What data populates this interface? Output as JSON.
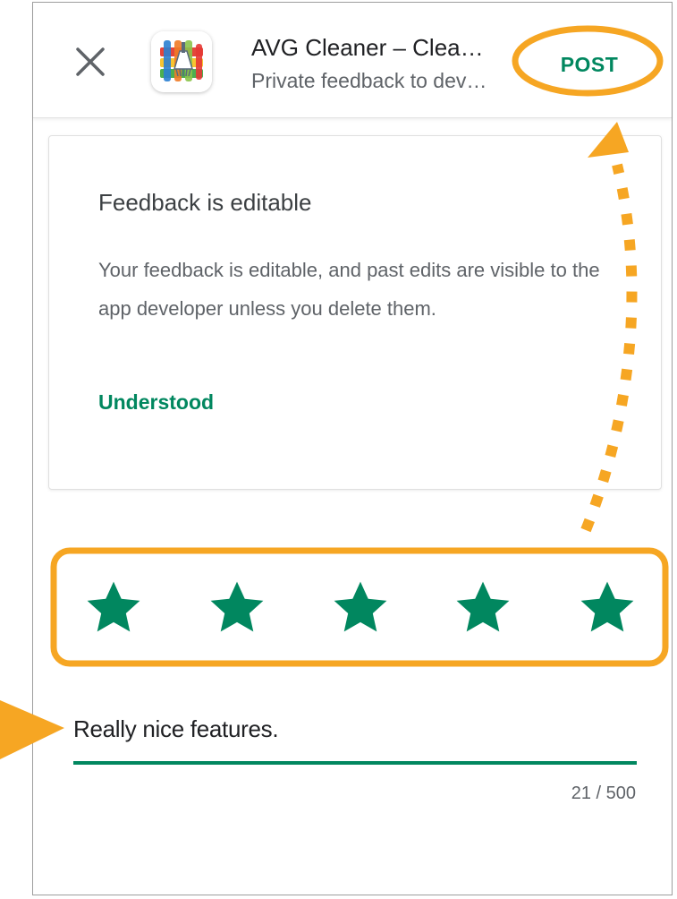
{
  "header": {
    "app_title": "AVG Cleaner – Clea…",
    "app_subtitle": "Private feedback to dev…",
    "post_label": "POST",
    "close_icon": "close-icon",
    "app_icon": "avg-cleaner-app-icon"
  },
  "notice_card": {
    "title": "Feedback is editable",
    "body": "Your feedback is editable, and past edits are visible to the app developer unless you delete them.",
    "action_label": "Understood"
  },
  "rating": {
    "value": 5,
    "max": 5,
    "star_icon": "star-icon"
  },
  "review": {
    "text": "Really nice features.",
    "counter": "21 / 500"
  },
  "colors": {
    "accent_green": "#01875f",
    "highlight_orange": "#f6a623",
    "title_text": "#202124",
    "secondary_text": "#5f6368"
  }
}
